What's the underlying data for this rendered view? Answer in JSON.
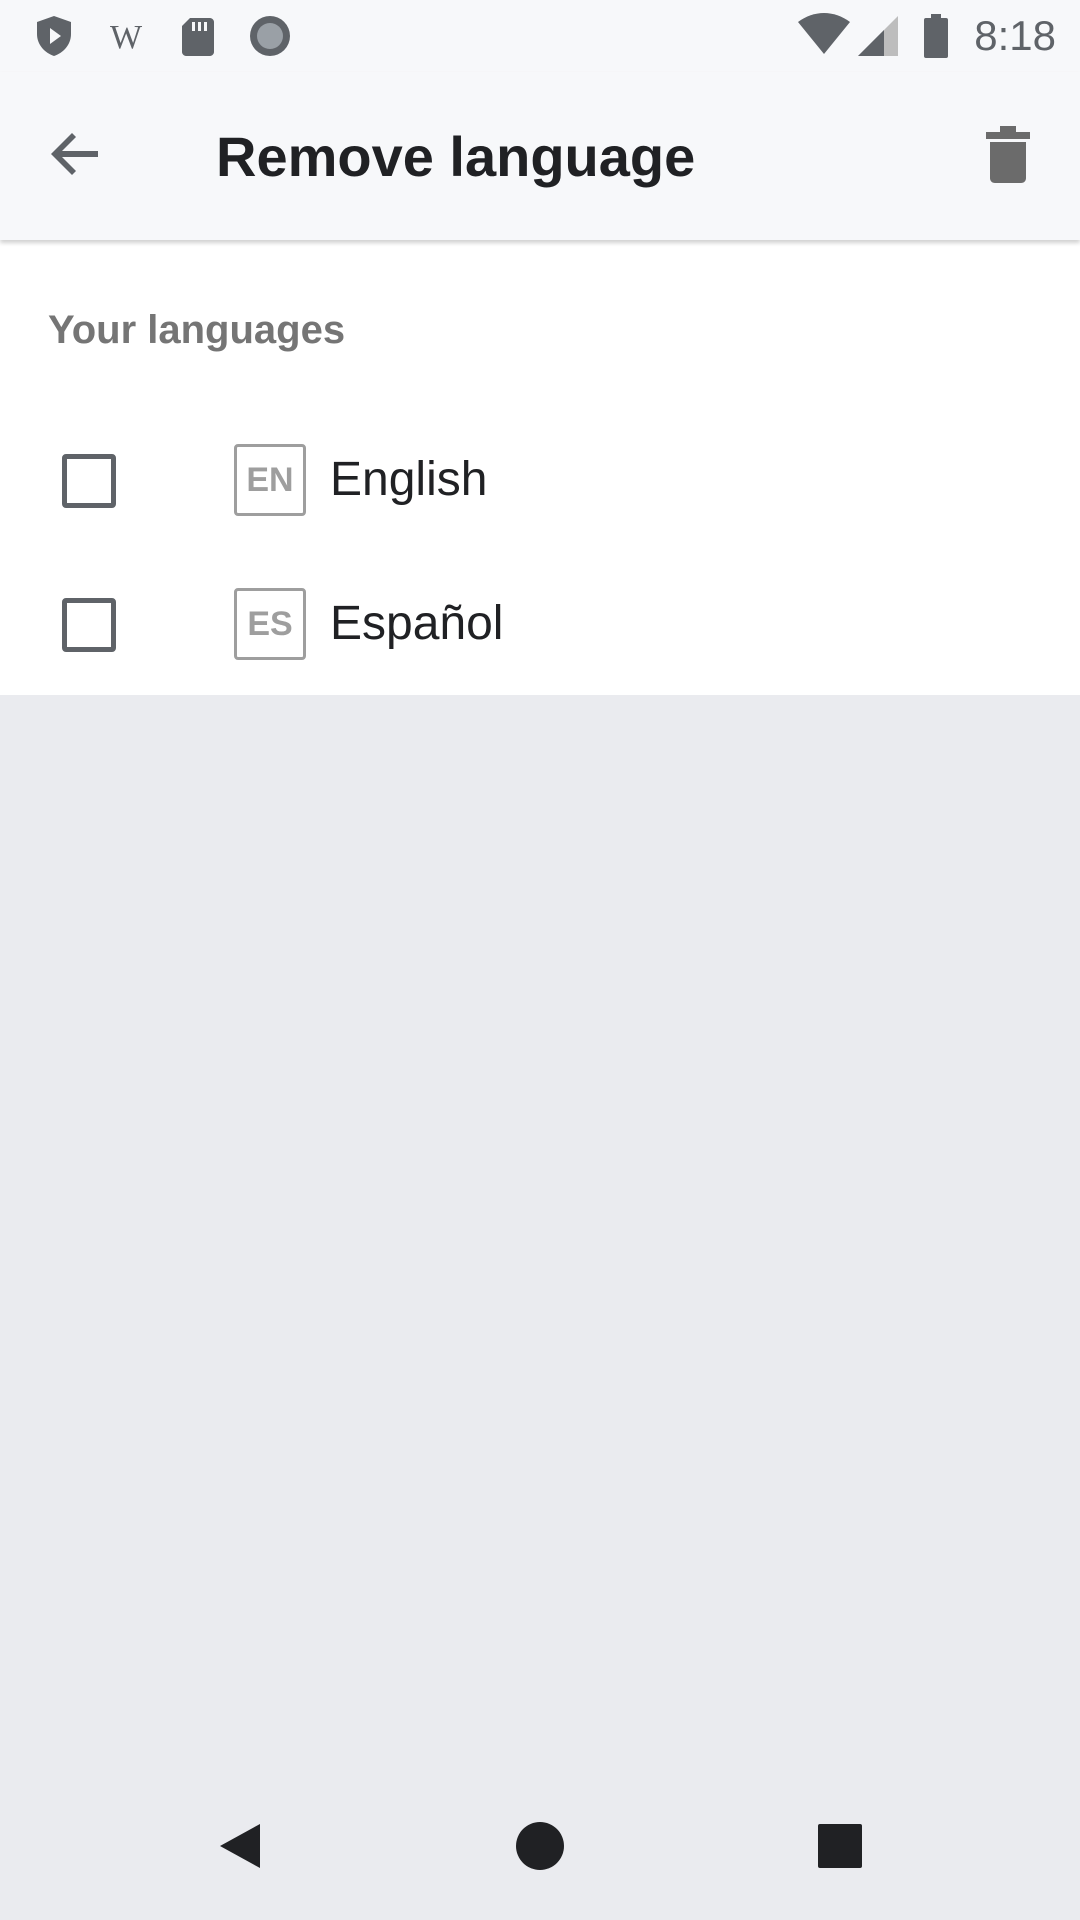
{
  "status_bar": {
    "time": "8:18",
    "left_icons": [
      "shield-play-icon",
      "wikipedia-icon",
      "sd-card-icon",
      "record-icon"
    ],
    "right_icons": [
      "wifi-icon",
      "cell-signal-icon",
      "battery-icon"
    ]
  },
  "app_bar": {
    "title": "Remove language",
    "back_icon": "arrow-back-icon",
    "action_icon": "trash-icon"
  },
  "section": {
    "header": "Your languages"
  },
  "languages": [
    {
      "code": "EN",
      "name": "English",
      "checked": false
    },
    {
      "code": "ES",
      "name": "Español",
      "checked": false
    }
  ],
  "nav_bar": {
    "icons": [
      "nav-back-icon",
      "nav-home-icon",
      "nav-recents-icon"
    ]
  },
  "colors": {
    "app_bar_bg": "#f7f8fa",
    "content_bg": "#ffffff",
    "background": "#eaebef",
    "icon_gray": "#5f6368",
    "title_text": "#202124",
    "secondary_text": "#757575",
    "badge_border": "#9e9e9e"
  }
}
